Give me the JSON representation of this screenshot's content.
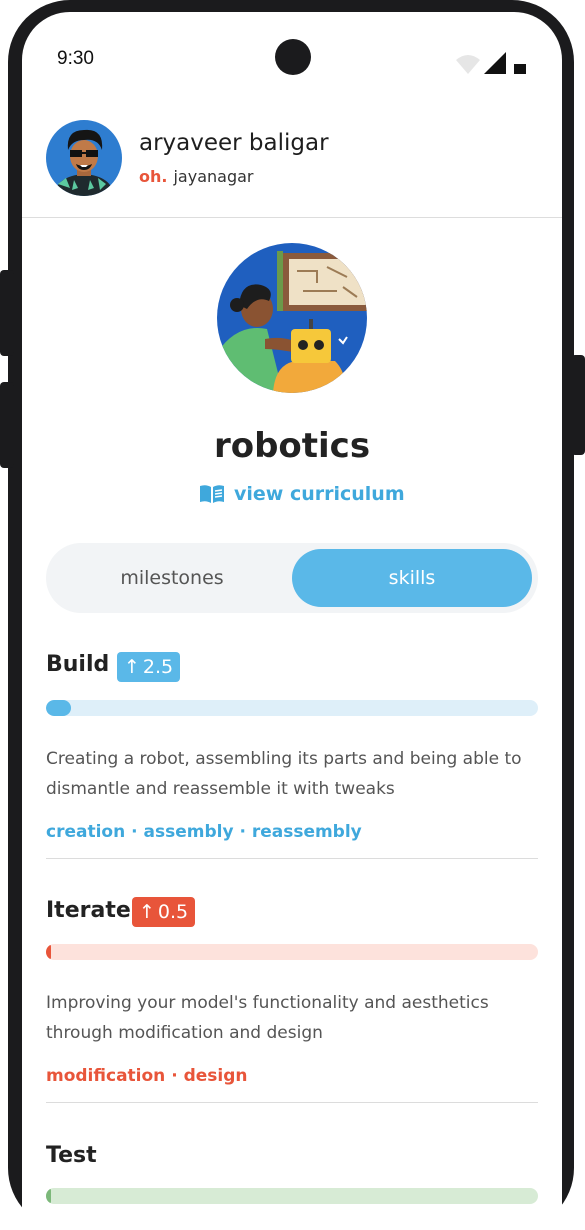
{
  "status_bar": {
    "time": "9:30"
  },
  "user": {
    "name": "aryaveer baligar",
    "brand": "oh.",
    "location": "jayanagar"
  },
  "course": {
    "title": "robotics",
    "curriculum_link": "view curriculum"
  },
  "tabs": {
    "milestones": "milestones",
    "skills": "skills",
    "active": "skills"
  },
  "skills": [
    {
      "name": "Build",
      "delta": "2.5",
      "level": 0.05,
      "color": "#5ab8e8",
      "track_color": "#deeff9",
      "description": "Creating a robot, assembling its parts and being able to dismantle and reassemble it with tweaks",
      "tags": "creation · assembly · reassembly"
    },
    {
      "name": "Iterate",
      "delta": "0.5",
      "level": 0.01,
      "color": "#e8553a",
      "track_color": "#fde2dc",
      "description": "Improving your model's functionality and aesthetics through modification and design",
      "tags": "modification · design"
    },
    {
      "name": "Test",
      "level": 0.01,
      "color": "#7cb87a",
      "track_color": "#d7ebd5"
    }
  ],
  "colors": {
    "accent": "#5ab8e8",
    "brand": "#e8553a"
  }
}
